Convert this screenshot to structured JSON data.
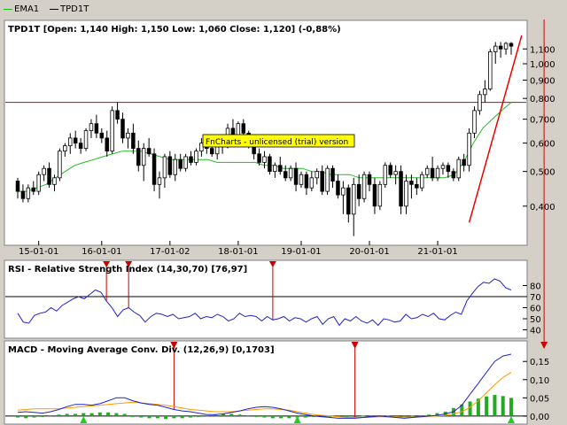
{
  "legend": [
    {
      "label": "EMA1",
      "color": "#22bb22"
    },
    {
      "label": "TPD1T",
      "color": "#000000"
    }
  ],
  "price_panel": {
    "title": "TPD1T [Open: 1,140  High: 1,150  Low: 1,060  Close: 1,120] (-0,88%)",
    "watermark": "FnCharts - unlicensed (trial) version",
    "y_ticks": [
      "1,100",
      "1,000",
      "0,900",
      "0,800",
      "0,700",
      "0,600",
      "0,500",
      "0,400"
    ],
    "x_ticks": [
      "15-01-01",
      "16-01-01",
      "17-01-02",
      "18-01-01",
      "19-01-01",
      "20-01-01",
      "21-01-01"
    ],
    "scale": "log",
    "horizontal_line_value": 0.78,
    "colors": {
      "up": "#ffffff",
      "down": "#000000",
      "ema": "#22bb22",
      "trendline": "#ee0000",
      "hline": "#aa1111"
    }
  },
  "rsi_panel": {
    "title": "RSI - Relative Strength Index (14,30,70) [76,97]",
    "y_ticks": [
      "80",
      "70",
      "60",
      "50",
      "40"
    ],
    "overbought": 70,
    "line_color": "#2222cc"
  },
  "macd_panel": {
    "title": "MACD - Moving Average Conv. Div. (12,26,9) [0,1703]",
    "y_ticks": [
      "0,15",
      "0,10",
      "0,05",
      "0,00"
    ],
    "colors": {
      "macd": "#2222cc",
      "signal": "#ff9900",
      "hist": "#22aa22"
    }
  },
  "chart_data": {
    "type": "candlestick",
    "scale": "log",
    "ylim": [
      0.32,
      1.2
    ],
    "x_ticks": [
      "15-01-01",
      "16-01-01",
      "17-01-02",
      "18-01-01",
      "19-01-01",
      "20-01-01",
      "21-01-01"
    ],
    "horizontal_line": 0.78,
    "ohlc": [
      [
        0.47,
        0.48,
        0.42,
        0.44
      ],
      [
        0.44,
        0.46,
        0.41,
        0.42
      ],
      [
        0.42,
        0.46,
        0.41,
        0.45
      ],
      [
        0.45,
        0.47,
        0.43,
        0.44
      ],
      [
        0.44,
        0.5,
        0.43,
        0.49
      ],
      [
        0.49,
        0.52,
        0.47,
        0.51
      ],
      [
        0.51,
        0.53,
        0.45,
        0.46
      ],
      [
        0.46,
        0.49,
        0.44,
        0.48
      ],
      [
        0.48,
        0.58,
        0.47,
        0.57
      ],
      [
        0.57,
        0.6,
        0.55,
        0.59
      ],
      [
        0.59,
        0.64,
        0.56,
        0.62
      ],
      [
        0.62,
        0.65,
        0.58,
        0.6
      ],
      [
        0.6,
        0.62,
        0.56,
        0.58
      ],
      [
        0.58,
        0.66,
        0.57,
        0.65
      ],
      [
        0.65,
        0.7,
        0.62,
        0.68
      ],
      [
        0.68,
        0.72,
        0.62,
        0.64
      ],
      [
        0.64,
        0.66,
        0.6,
        0.62
      ],
      [
        0.62,
        0.65,
        0.55,
        0.57
      ],
      [
        0.57,
        0.76,
        0.56,
        0.74
      ],
      [
        0.74,
        0.78,
        0.68,
        0.7
      ],
      [
        0.7,
        0.73,
        0.6,
        0.62
      ],
      [
        0.62,
        0.66,
        0.58,
        0.64
      ],
      [
        0.64,
        0.68,
        0.56,
        0.58
      ],
      [
        0.58,
        0.61,
        0.5,
        0.52
      ],
      [
        0.52,
        0.6,
        0.47,
        0.58
      ],
      [
        0.58,
        0.62,
        0.55,
        0.56
      ],
      [
        0.56,
        0.58,
        0.44,
        0.46
      ],
      [
        0.46,
        0.5,
        0.42,
        0.48
      ],
      [
        0.48,
        0.56,
        0.45,
        0.55
      ],
      [
        0.55,
        0.57,
        0.48,
        0.49
      ],
      [
        0.49,
        0.56,
        0.47,
        0.54
      ],
      [
        0.54,
        0.56,
        0.5,
        0.51
      ],
      [
        0.51,
        0.56,
        0.5,
        0.55
      ],
      [
        0.55,
        0.57,
        0.52,
        0.53
      ],
      [
        0.53,
        0.58,
        0.52,
        0.57
      ],
      [
        0.57,
        0.62,
        0.55,
        0.6
      ],
      [
        0.6,
        0.63,
        0.56,
        0.58
      ],
      [
        0.58,
        0.61,
        0.55,
        0.56
      ],
      [
        0.56,
        0.6,
        0.54,
        0.59
      ],
      [
        0.59,
        0.62,
        0.56,
        0.6
      ],
      [
        0.6,
        0.68,
        0.58,
        0.66
      ],
      [
        0.66,
        0.7,
        0.6,
        0.62
      ],
      [
        0.62,
        0.69,
        0.61,
        0.68
      ],
      [
        0.68,
        0.7,
        0.62,
        0.64
      ],
      [
        0.64,
        0.65,
        0.58,
        0.6
      ],
      [
        0.6,
        0.61,
        0.54,
        0.56
      ],
      [
        0.56,
        0.58,
        0.52,
        0.53
      ],
      [
        0.53,
        0.57,
        0.51,
        0.55
      ],
      [
        0.55,
        0.56,
        0.49,
        0.5
      ],
      [
        0.5,
        0.53,
        0.48,
        0.52
      ],
      [
        0.52,
        0.55,
        0.49,
        0.5
      ],
      [
        0.5,
        0.52,
        0.47,
        0.48
      ],
      [
        0.48,
        0.52,
        0.47,
        0.51
      ],
      [
        0.51,
        0.53,
        0.44,
        0.46
      ],
      [
        0.46,
        0.5,
        0.45,
        0.49
      ],
      [
        0.49,
        0.5,
        0.43,
        0.45
      ],
      [
        0.45,
        0.5,
        0.44,
        0.48
      ],
      [
        0.48,
        0.51,
        0.46,
        0.5
      ],
      [
        0.5,
        0.52,
        0.43,
        0.44
      ],
      [
        0.44,
        0.52,
        0.43,
        0.51
      ],
      [
        0.51,
        0.52,
        0.45,
        0.47
      ],
      [
        0.47,
        0.49,
        0.42,
        0.43
      ],
      [
        0.43,
        0.47,
        0.38,
        0.45
      ],
      [
        0.45,
        0.46,
        0.36,
        0.38
      ],
      [
        0.38,
        0.48,
        0.33,
        0.46
      ],
      [
        0.46,
        0.49,
        0.4,
        0.42
      ],
      [
        0.42,
        0.5,
        0.41,
        0.49
      ],
      [
        0.49,
        0.5,
        0.44,
        0.46
      ],
      [
        0.46,
        0.48,
        0.38,
        0.4
      ],
      [
        0.4,
        0.47,
        0.39,
        0.46
      ],
      [
        0.46,
        0.53,
        0.45,
        0.52
      ],
      [
        0.52,
        0.53,
        0.48,
        0.49
      ],
      [
        0.49,
        0.52,
        0.46,
        0.5
      ],
      [
        0.5,
        0.52,
        0.38,
        0.4
      ],
      [
        0.4,
        0.49,
        0.38,
        0.47
      ],
      [
        0.47,
        0.49,
        0.42,
        0.46
      ],
      [
        0.46,
        0.48,
        0.43,
        0.45
      ],
      [
        0.45,
        0.5,
        0.44,
        0.49
      ],
      [
        0.49,
        0.52,
        0.48,
        0.51
      ],
      [
        0.51,
        0.55,
        0.47,
        0.48
      ],
      [
        0.48,
        0.52,
        0.47,
        0.51
      ],
      [
        0.51,
        0.53,
        0.49,
        0.52
      ],
      [
        0.52,
        0.53,
        0.48,
        0.5
      ],
      [
        0.5,
        0.51,
        0.47,
        0.48
      ],
      [
        0.48,
        0.55,
        0.47,
        0.54
      ],
      [
        0.54,
        0.56,
        0.5,
        0.52
      ],
      [
        0.52,
        0.66,
        0.5,
        0.64
      ],
      [
        0.64,
        0.76,
        0.62,
        0.74
      ],
      [
        0.74,
        0.84,
        0.72,
        0.82
      ],
      [
        0.82,
        0.9,
        0.78,
        0.85
      ],
      [
        0.85,
        1.1,
        0.84,
        1.08
      ],
      [
        1.08,
        1.15,
        1.0,
        1.12
      ],
      [
        1.12,
        1.15,
        1.04,
        1.1
      ],
      [
        1.1,
        1.15,
        1.06,
        1.14
      ],
      [
        1.14,
        1.15,
        1.06,
        1.12
      ]
    ],
    "ema": [
      0.44,
      0.44,
      0.45,
      0.46,
      0.48,
      0.5,
      0.52,
      0.53,
      0.54,
      0.55,
      0.56,
      0.57,
      0.57,
      0.57,
      0.56,
      0.55,
      0.54,
      0.54,
      0.54,
      0.54,
      0.54,
      0.53,
      0.53,
      0.53,
      0.53,
      0.53,
      0.52,
      0.52,
      0.51,
      0.51,
      0.51,
      0.5,
      0.5,
      0.49,
      0.49,
      0.49,
      0.48,
      0.48,
      0.48,
      0.48,
      0.48,
      0.48,
      0.48,
      0.48,
      0.48,
      0.48,
      0.49,
      0.53,
      0.6,
      0.66,
      0.7,
      0.74,
      0.78
    ],
    "trendline": [
      {
        "i": 86,
        "v": 0.36
      },
      {
        "i": 96,
        "v": 1.2
      }
    ],
    "rsi": [
      55,
      47,
      46,
      53,
      55,
      56,
      60,
      57,
      62,
      65,
      68,
      70,
      68,
      72,
      76,
      74,
      66,
      60,
      52,
      58,
      60,
      56,
      53,
      47,
      52,
      55,
      54,
      52,
      54,
      50,
      51,
      52,
      55,
      50,
      52,
      51,
      54,
      52,
      48,
      50,
      55,
      52,
      53,
      52,
      48,
      52,
      49,
      50,
      52,
      48,
      51,
      50,
      47,
      50,
      52,
      45,
      50,
      52,
      44,
      50,
      48,
      52,
      48,
      46,
      49,
      44,
      50,
      49,
      47,
      48,
      54,
      50,
      51,
      54,
      52,
      55,
      50,
      49,
      53,
      56,
      54,
      66,
      73,
      79,
      83,
      82,
      86,
      84,
      78,
      76
    ],
    "rsi_markers": [
      16,
      20,
      46
    ],
    "macd": [
      0.01,
      0.012,
      0.01,
      0.008,
      0.012,
      0.018,
      0.026,
      0.032,
      0.032,
      0.03,
      0.034,
      0.042,
      0.05,
      0.05,
      0.042,
      0.036,
      0.032,
      0.03,
      0.024,
      0.018,
      0.014,
      0.012,
      0.008,
      0.004,
      0.004,
      0.006,
      0.01,
      0.014,
      0.02,
      0.024,
      0.026,
      0.024,
      0.02,
      0.014,
      0.008,
      0.004,
      0.0,
      -0.002,
      -0.004,
      -0.006,
      -0.006,
      -0.006,
      -0.004,
      -0.002,
      0.0,
      -0.002,
      -0.004,
      -0.006,
      -0.004,
      -0.002,
      0.0,
      0.002,
      0.006,
      0.012,
      0.03,
      0.06,
      0.09,
      0.12,
      0.15,
      0.165,
      0.17
    ],
    "signal": [
      0.016,
      0.018,
      0.02,
      0.02,
      0.02,
      0.02,
      0.022,
      0.024,
      0.026,
      0.028,
      0.03,
      0.032,
      0.034,
      0.036,
      0.038,
      0.036,
      0.034,
      0.032,
      0.03,
      0.026,
      0.022,
      0.018,
      0.016,
      0.014,
      0.012,
      0.012,
      0.012,
      0.014,
      0.016,
      0.018,
      0.02,
      0.02,
      0.018,
      0.016,
      0.012,
      0.008,
      0.004,
      0.002,
      0.0,
      -0.002,
      -0.004,
      -0.004,
      -0.004,
      -0.003,
      -0.002,
      -0.002,
      -0.002,
      -0.003,
      -0.003,
      -0.002,
      -0.001,
      0.0,
      0.002,
      0.006,
      0.012,
      0.024,
      0.042,
      0.064,
      0.086,
      0.106,
      0.12
    ],
    "hist": [
      -0.004,
      -0.006,
      -0.004,
      -0.002,
      0.002,
      0.004,
      0.006,
      0.006,
      0.008,
      0.008,
      0.01,
      0.01,
      0.008,
      0.006,
      -0.002,
      -0.004,
      -0.006,
      -0.006,
      -0.008,
      -0.006,
      -0.006,
      -0.004,
      -0.002,
      0.002,
      0.004,
      0.006,
      0.006,
      0.004,
      0.002,
      -0.002,
      -0.004,
      -0.006,
      -0.006,
      -0.006,
      -0.004,
      -0.004,
      -0.002,
      -0.002,
      -0.002,
      -0.002,
      0.0,
      0.0,
      0.001,
      0.002,
      0.002,
      0.001,
      0.0,
      -0.001,
      0.001,
      0.002,
      0.004,
      0.008,
      0.012,
      0.022,
      0.032,
      0.04,
      0.048,
      0.054,
      0.058,
      0.055,
      0.05
    ],
    "macd_markers": [
      19,
      41,
      64
    ],
    "macd_arrows": [
      8,
      34,
      60,
      70
    ]
  }
}
